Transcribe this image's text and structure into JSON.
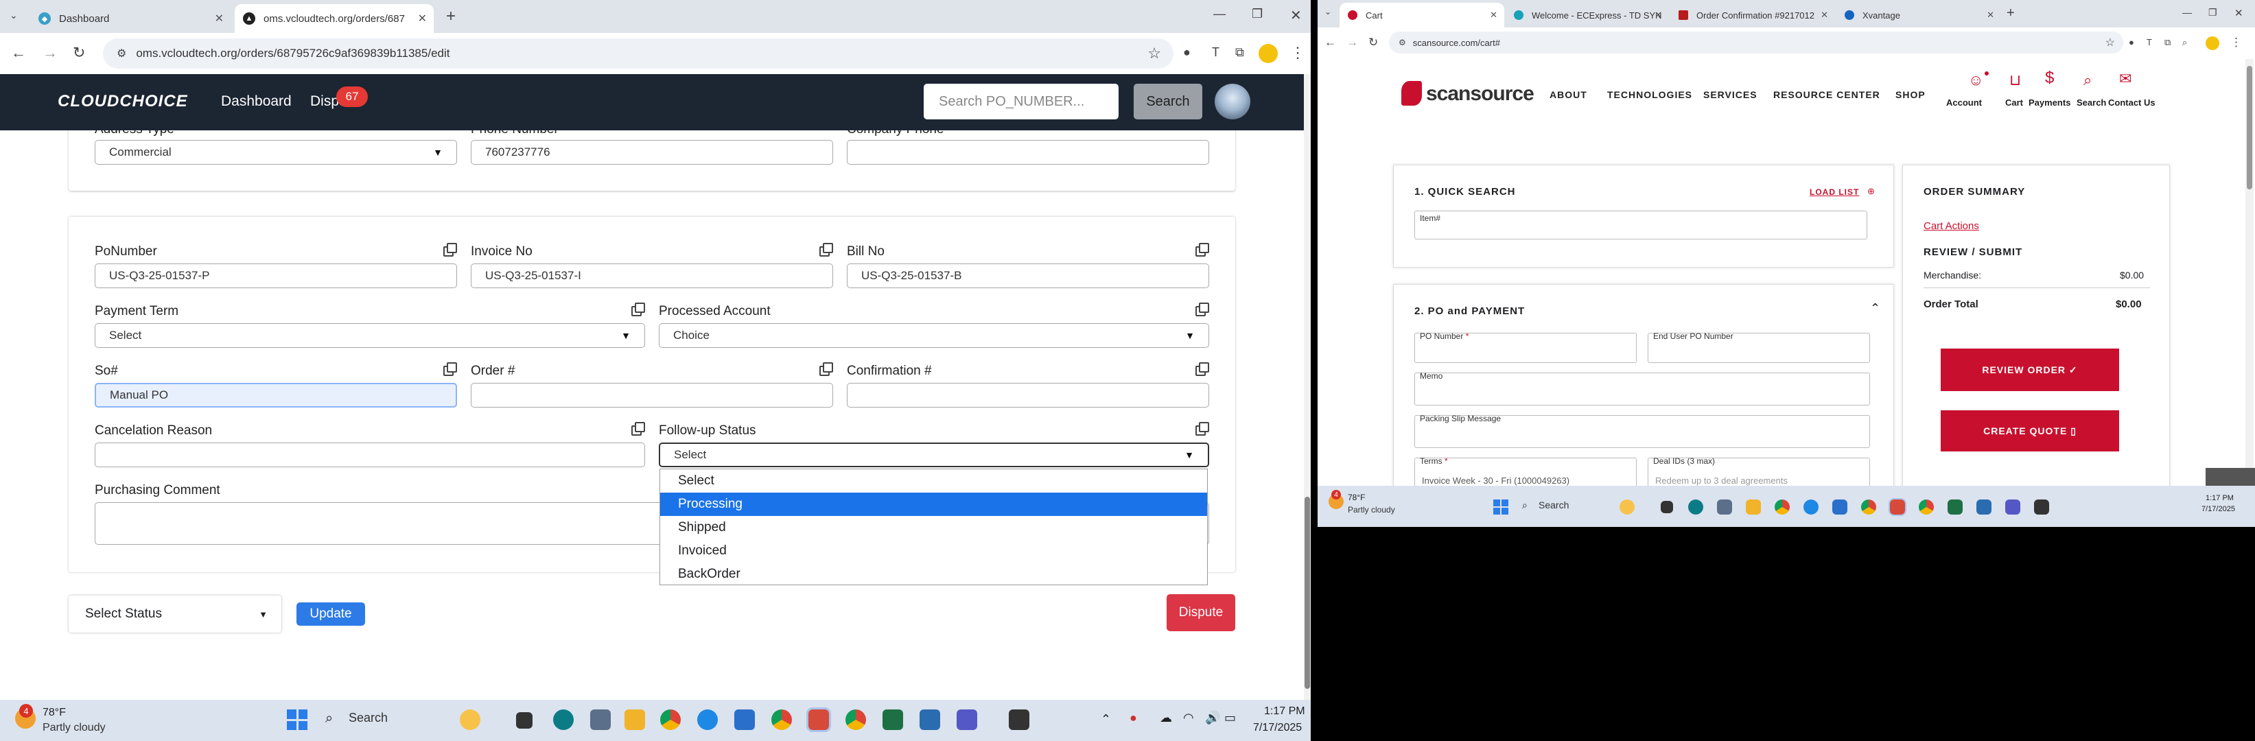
{
  "left_browser": {
    "tabs": [
      {
        "title": "Dashboard",
        "active": false
      },
      {
        "title": "oms.vcloudtech.org/orders/687",
        "active": true
      }
    ],
    "url": "oms.vcloudtech.org/orders/68795726c9af369839b11385/edit"
  },
  "oms": {
    "logo": "CLOUDCHOICE",
    "nav": [
      "Dashboard",
      "Dispu"
    ],
    "dispute_badge": "67",
    "search_placeholder": "Search PO_NUMBER...",
    "search_button": "Search",
    "top_labels": {
      "address_type": "Address Type",
      "phone_number": "Phone Number",
      "company_phone": "Company Phone"
    },
    "address_type": "Commercial",
    "phone_number": "7607237776",
    "company_phone": "",
    "labels": {
      "po": "PoNumber",
      "invoice": "Invoice No",
      "bill": "Bill No",
      "payment_term": "Payment Term",
      "processed_account": "Processed Account",
      "so": "So#",
      "order": "Order #",
      "confirmation": "Confirmation #",
      "cancel_reason": "Cancelation Reason",
      "followup": "Follow-up Status",
      "comment": "Purchasing Comment"
    },
    "values": {
      "po": "US-Q3-25-01537-P",
      "invoice": "US-Q3-25-01537-I",
      "bill": "US-Q3-25-01537-B",
      "payment_term": "Select",
      "processed_account": "Choice",
      "so": "Manual PO",
      "order": "",
      "confirmation": "",
      "cancel_reason": "",
      "followup": "Select"
    },
    "followup_options": [
      "Select",
      "Processing",
      "Shipped",
      "Invoiced",
      "BackOrder"
    ],
    "highlighted_option": "Processing",
    "status_select": "Select Status",
    "update_button": "Update",
    "dispute_button": "Dispute"
  },
  "left_taskbar": {
    "weather_temp": "78°F",
    "weather_desc": "Partly cloudy",
    "weather_badge": "4",
    "search": "Search",
    "time": "1:17 PM",
    "date": "7/17/2025"
  },
  "right_browser": {
    "tabs": [
      {
        "title": "Cart",
        "active": true
      },
      {
        "title": "Welcome - ECExpress - TD SYN",
        "active": false
      },
      {
        "title": "Order Confirmation #9217012",
        "active": false
      },
      {
        "title": "Xvantage",
        "active": false
      }
    ],
    "url": "scansource.com/cart#"
  },
  "scansource": {
    "logo": "scansource",
    "nav": [
      "ABOUT",
      "TECHNOLOGIES",
      "SERVICES",
      "RESOURCE CENTER",
      "SHOP"
    ],
    "icons": [
      "Account",
      "Cart",
      "Payments",
      "Search",
      "Contact Us"
    ],
    "quick_search_title": "1. QUICK SEARCH",
    "load_list": "LOAD LIST",
    "item_label": "Item#",
    "po_payment_title": "2. PO and PAYMENT",
    "po_number_label": "PO Number",
    "end_user_po_label": "End User PO Number",
    "memo_label": "Memo",
    "packing_label": "Packing Slip Message",
    "terms_label": "Terms",
    "terms_value": "Invoice Week - 30 - Fri (1000049263)",
    "deal_label": "Deal IDs (3 max)",
    "deal_placeholder": "Redeem up to 3 deal agreements",
    "summary_title": "ORDER SUMMARY",
    "cart_actions": "Cart Actions",
    "review_submit": "REVIEW / SUBMIT",
    "merchandise_label": "Merchandise:",
    "merchandise_value": "$0.00",
    "order_total_label": "Order Total",
    "order_total_value": "$0.00",
    "review_button": "REVIEW ORDER ✓",
    "quote_button": "CREATE QUOTE"
  },
  "right_taskbar": {
    "weather_temp": "78°F",
    "weather_desc": "Partly cloudy",
    "weather_badge": "4",
    "search": "Search",
    "time": "1:17 PM",
    "date": "7/17/2025"
  }
}
